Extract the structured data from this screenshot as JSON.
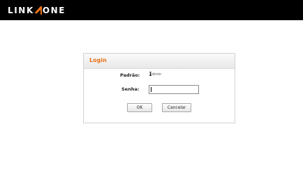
{
  "brand": {
    "name_left": "LINK",
    "name_right": "ONE",
    "accent_color": "#e8711a"
  },
  "login": {
    "title": "Login",
    "default_label": "Padrão:",
    "default_value": "admin",
    "password_label": "Senha:",
    "password_value": "",
    "ok_label": "OK",
    "cancel_label": "Cancelar"
  },
  "icons": {
    "cursor": "text-cursor-icon",
    "logo_mark": "link-one-mark-icon"
  }
}
